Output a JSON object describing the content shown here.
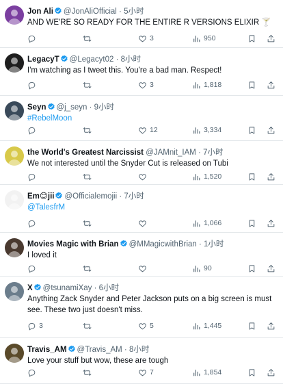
{
  "tweets": [
    {
      "name": "Jon Ali",
      "verified": true,
      "handle": "@JonAliOfficial",
      "time": "5小时",
      "text": "AND WE'RE SO READY FOR THE ENTIRE R VERSIONS ELIXIR 🍸",
      "link": "",
      "replies": "",
      "retweets": "",
      "likes": "3",
      "views": "950",
      "avatar_color": "#7b3fa0"
    },
    {
      "name": "LegacyT",
      "verified": true,
      "handle": "@Legacyt02",
      "time": "8小时",
      "text": "I'm watching as I tweet this. You're a bad man. Respect!",
      "link": "",
      "replies": "",
      "retweets": "",
      "likes": "3",
      "views": "1,818",
      "avatar_color": "#1e1e1e"
    },
    {
      "name": "Seyn",
      "verified": true,
      "handle": "@j_seyn",
      "time": "9小时",
      "text": "",
      "link": "#RebelMoon",
      "replies": "",
      "retweets": "",
      "likes": "12",
      "views": "3,334",
      "avatar_color": "#3a4a5a"
    },
    {
      "name": "the World's Greatest Narcissist",
      "verified": false,
      "handle": "@JAMnit_IAM",
      "time": "7小时",
      "text": "We not interested until the Snyder Cut is released on Tubi",
      "link": "",
      "replies": "",
      "retweets": "",
      "likes": "",
      "views": "1,520",
      "avatar_color": "#d8c94a"
    },
    {
      "name": "Em😊jii",
      "verified": true,
      "handle": "@Officialemojii",
      "time": "7小时",
      "text": "",
      "link": "@TalesfrM",
      "replies": "",
      "retweets": "",
      "likes": "",
      "views": "1,066",
      "avatar_color": "#f2f2f2"
    },
    {
      "name": "Movies Magic with Brian",
      "verified": true,
      "handle": "@MMagicwithBrian",
      "time": "1小时",
      "text": "I loved it",
      "link": "",
      "replies": "",
      "retweets": "",
      "likes": "",
      "views": "90",
      "avatar_color": "#4a3a30"
    },
    {
      "name": "X",
      "verified": true,
      "handle": "@tsunamiXay",
      "time": "6小时",
      "text": "Anything Zack Snyder and Peter Jackson puts on a big screen is must see. These two just doesn't miss.",
      "link": "",
      "replies": "3",
      "retweets": "",
      "likes": "5",
      "views": "1,445",
      "avatar_color": "#6b7d8c"
    },
    {
      "name": "Travis_AM",
      "verified": true,
      "handle": "@Travis_AM",
      "time": "8小时",
      "text": "Love your stuff but wow, these are tough",
      "link": "",
      "replies": "",
      "retweets": "",
      "likes": "7",
      "views": "1,854",
      "avatar_color": "#5a4a2a"
    }
  ],
  "colors": {
    "accent": "#1d9bf0",
    "muted": "#536471",
    "text": "#0f1419",
    "divider": "#e3e7ea"
  },
  "icons": [
    "reply-icon",
    "retweet-icon",
    "like-icon",
    "views-icon",
    "bookmark-icon",
    "share-icon",
    "verified-badge-icon"
  ]
}
